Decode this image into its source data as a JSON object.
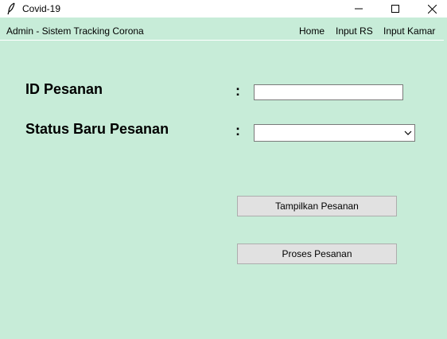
{
  "window": {
    "title": "Covid-19",
    "icon": "feather-icon",
    "minimize_glyph": "—",
    "controls": [
      "minimize-icon",
      "maximize-icon",
      "close-icon"
    ]
  },
  "menubar": {
    "title": "Admin - Sistem Tracking Corona",
    "items": [
      {
        "label": "Home"
      },
      {
        "label": "Input RS"
      },
      {
        "label": "Input Kamar"
      }
    ]
  },
  "form": {
    "id_label": "ID Pesanan",
    "status_label": "Status Baru Pesanan",
    "colon": ":",
    "id_value": "",
    "status_value": ""
  },
  "buttons": {
    "tampilkan": "Tampilkan Pesanan",
    "proses": "Proses Pesanan"
  },
  "colors": {
    "background": "#c7ecd8",
    "button": "#e1e1e1"
  }
}
